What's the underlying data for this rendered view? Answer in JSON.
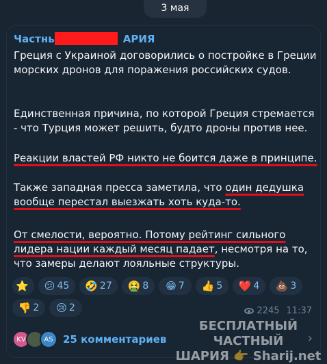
{
  "date_pill": "3 мая",
  "post": {
    "author_visible_start": "Частны",
    "author_visible_end": "АРИЯ",
    "paragraph1": "Греция с Украиной договорились о постройке в Греции морских дронов для поражения российских судов.",
    "paragraph2": "Единственная причина, по которой Греция стремается - что Турция может решить, будто дроны против нее.",
    "paragraph3": "Реакции властей РФ никто не боится даже в принципе.",
    "paragraph4_plain": "Также западная пресса заметила, что ",
    "paragraph4_underlined": "один дедушка вообще перестал выезжать хоть куда-то.",
    "paragraph5_underlined": "От смелости, вероятно. Потому рейтинг сильного лидера нации каждый месяц падает",
    "paragraph5_plain": ", несмотря на то, что замеры делают лояльные структуры."
  },
  "reactions": [
    {
      "emoji": "⭐",
      "count": ""
    },
    {
      "emoji": "😕",
      "count": "45"
    },
    {
      "emoji": "🤣",
      "count": "27"
    },
    {
      "emoji": "🤮",
      "count": "8"
    },
    {
      "emoji": "😁",
      "count": "7"
    },
    {
      "emoji": "👍",
      "count": "5"
    },
    {
      "emoji": "❤️",
      "count": "4"
    },
    {
      "emoji": "💩",
      "count": "3"
    },
    {
      "emoji": "👎",
      "count": "2"
    },
    {
      "emoji": "😢",
      "count": "2"
    }
  ],
  "meta": {
    "views": "2245",
    "time": "11:37"
  },
  "comments": {
    "label": "25 комментариев",
    "avatars": [
      {
        "initials": "KV",
        "color": "#d45a8e"
      },
      {
        "initials": "",
        "color": "#4a5a45"
      },
      {
        "initials": "AS",
        "color": "#3b86c6"
      }
    ]
  },
  "watermark": {
    "line1": "БЕСПЛАТНЫЙ ЧАСТНЫЙ",
    "line2": "ШАРИЯ 👉 Sharij.net"
  }
}
